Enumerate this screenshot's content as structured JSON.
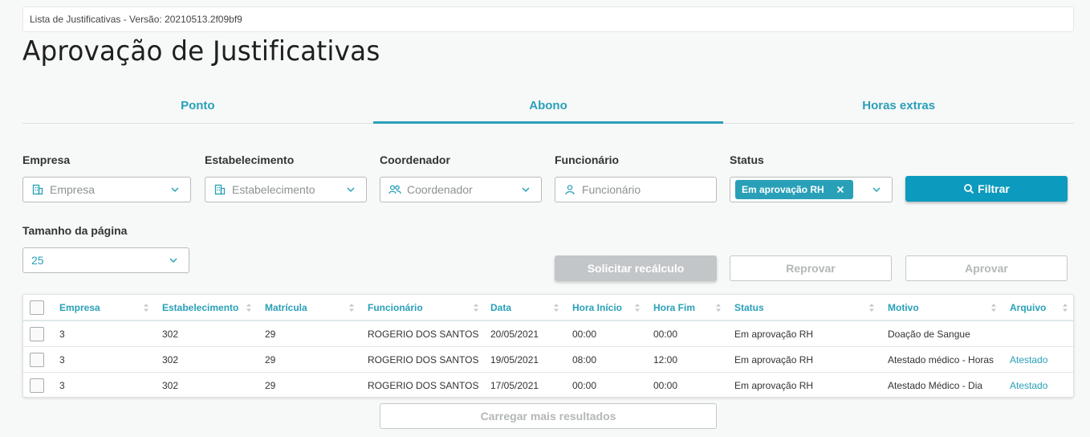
{
  "version_text": "Lista de Justificativas - Versão: 20210513.2f09bf9",
  "title": "Aprovação de Justificativas",
  "tabs": [
    {
      "label": "Ponto",
      "active": false
    },
    {
      "label": "Abono",
      "active": true
    },
    {
      "label": "Horas extras",
      "active": false
    }
  ],
  "filters": {
    "empresa": {
      "label": "Empresa",
      "placeholder": "Empresa"
    },
    "estabelecimento": {
      "label": "Estabelecimento",
      "placeholder": "Estabelecimento"
    },
    "coordenador": {
      "label": "Coordenador",
      "placeholder": "Coordenador"
    },
    "funcionario": {
      "label": "Funcionário",
      "placeholder": "Funcionário"
    },
    "status": {
      "label": "Status",
      "chip": "Em aprovação RH"
    },
    "filtrar_label": "Filtrar"
  },
  "page_size": {
    "label": "Tamanho da página",
    "value": "25"
  },
  "actions": {
    "recalculo": "Solicitar recálculo",
    "reprovar": "Reprovar",
    "aprovar": "Aprovar"
  },
  "table": {
    "columns": [
      "Empresa",
      "Estabelecimento",
      "Matrícula",
      "Funcionário",
      "Data",
      "Hora Início",
      "Hora Fim",
      "Status",
      "Motivo",
      "Arquivo"
    ],
    "rows": [
      [
        "3",
        "302",
        "29",
        "ROGERIO DOS SANTOS",
        "20/05/2021",
        "00:00",
        "00:00",
        "Em aprovação RH",
        "Doação de Sangue",
        ""
      ],
      [
        "3",
        "302",
        "29",
        "ROGERIO DOS SANTOS",
        "19/05/2021",
        "08:00",
        "12:00",
        "Em aprovação RH",
        "Atestado médico - Horas",
        "Atestado"
      ],
      [
        "3",
        "302",
        "29",
        "ROGERIO DOS SANTOS",
        "17/05/2021",
        "00:00",
        "00:00",
        "Em aprovação RH",
        "Atestado Médico - Dia",
        "Atestado"
      ]
    ]
  },
  "load_more": "Carregar mais resultados",
  "colors": {
    "accent": "#29a0b8",
    "primary_button": "#0c9abe"
  }
}
